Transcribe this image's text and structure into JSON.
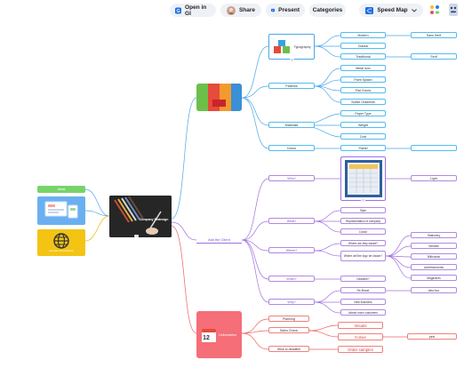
{
  "toolbar": {
    "open_in": "Open in GI",
    "share": "Share",
    "present": "Present",
    "categories": "Categories",
    "speed_map": "Speed Map"
  },
  "colors": {
    "blue_branch": "#4aa8e8",
    "purple_branch": "#a070e0",
    "red_branch": "#ee6060",
    "green_node": "#78d36a",
    "blue_node": "#6ab0f0",
    "yellow_node": "#f3c414",
    "pink_node": "#f56e78"
  },
  "map": {
    "root_caption": "Company Redesign",
    "left_green": "Ideas",
    "left_yellow": "Domain and website",
    "branch_ask": "Ask the Client",
    "branch_red": "Deliverables",
    "typography": "Typography",
    "patterns": "Patterns",
    "materials": "Materials",
    "colour": "Colour",
    "modern": "Modern",
    "classic": "Classic",
    "traditional": "Traditional",
    "sans_serif": "Sans Serif",
    "serif": "Serif",
    "metal_icon": "Metal icon",
    "paint_splash": "Paint Splash",
    "flat_colors": "Flat Colors",
    "subtle_gradients": "Subtle Gradients",
    "paper_type": "Paper Type",
    "weight": "Weight",
    "cost": "Cost",
    "pastel": "Pastel",
    "who": "Who?",
    "what": "What?",
    "where": "Where?",
    "when": "When?",
    "why": "Why?",
    "light": "Light",
    "style": "Style",
    "representation": "Representation of company",
    "colour2": "Colour",
    "where_based": "Where are they based?",
    "where_logo": "Where will the logo be shown?",
    "stationery": "Stationery",
    "website": "Website",
    "billboards": "Billboards",
    "advertisements": "Advertisements",
    "magazines": "Magazines",
    "deadline": "Deadline?",
    "re_brand": "Re-Brand",
    "new_business": "New Business",
    "attract": "Attract more customers",
    "idea_four": "Idea four",
    "planning": "Planning",
    "sales_check": "Sales Check",
    "visuals": "Visuals",
    "colour3": "Colour",
    "pink": "pink",
    "stick_deadline": "Stick to deadline",
    "order_samples": "Order samples",
    "badge1": "1",
    "badge2": "2",
    "badge3": "3"
  }
}
